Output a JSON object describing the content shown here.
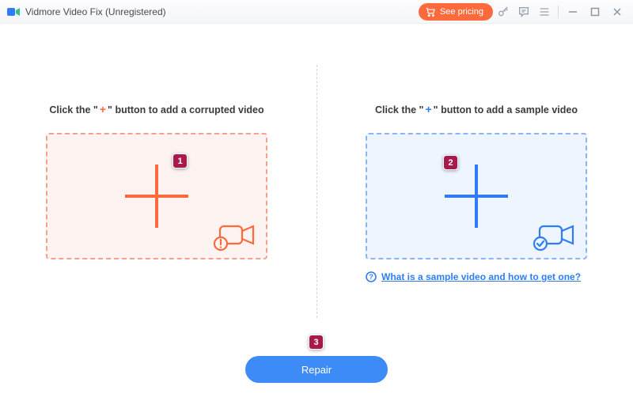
{
  "titlebar": {
    "app_name": "Vidmore Video Fix (Unregistered)",
    "pricing_label": "See pricing"
  },
  "left": {
    "prompt_pre": "Click the \"",
    "prompt_post": "\" button to add a corrupted video"
  },
  "right": {
    "prompt_pre": "Click the \"",
    "prompt_post": "\" button to add a sample video",
    "help_text": "What is a sample video and how to get one?"
  },
  "repair_label": "Repair",
  "callouts": {
    "one": "1",
    "two": "2",
    "three": "3"
  },
  "colors": {
    "accent_orange": "#ff6a3d",
    "accent_blue": "#2f7df6",
    "callout": "#a91a4c"
  }
}
